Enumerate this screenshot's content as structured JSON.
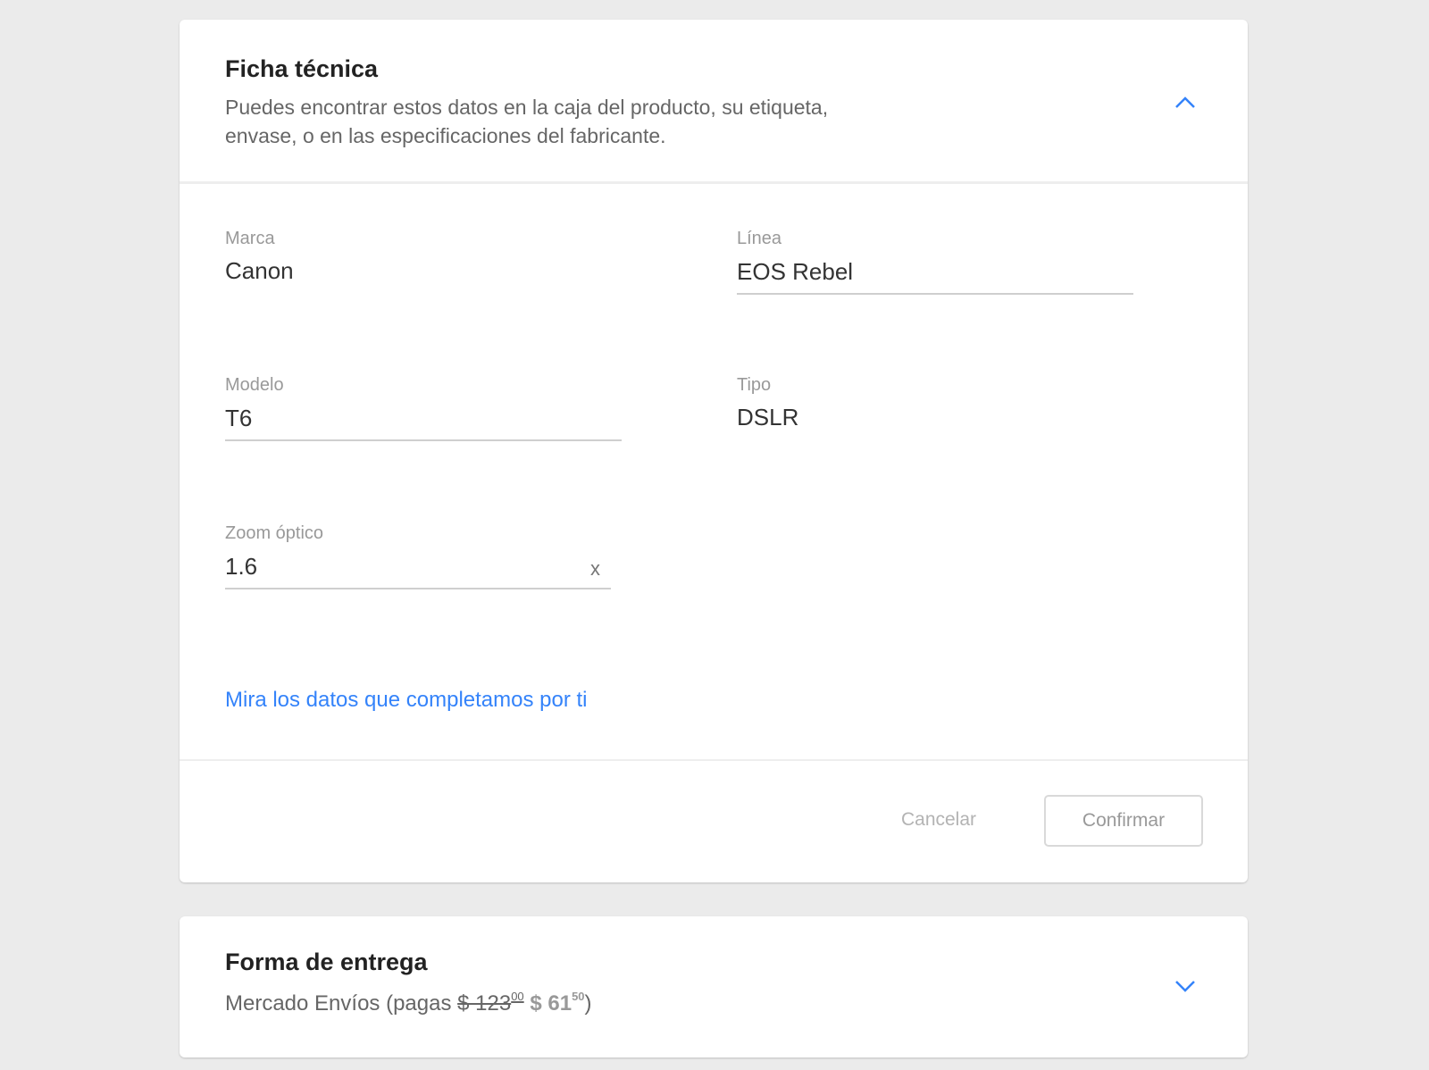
{
  "ficha": {
    "title": "Ficha técnica",
    "subtitle": "Puedes encontrar estos datos en la caja del producto, su etiqueta, envase, o en las especificaciones del fabricante.",
    "toggle_icon": "chevron-up-icon",
    "fields": {
      "marca": {
        "label": "Marca",
        "value": "Canon"
      },
      "linea": {
        "label": "Línea",
        "value": "EOS Rebel"
      },
      "modelo": {
        "label": "Modelo",
        "value": "T6"
      },
      "tipo": {
        "label": "Tipo",
        "value": "DSLR"
      },
      "zoom": {
        "label": "Zoom óptico",
        "value": "1.6",
        "clear_label": "x"
      }
    },
    "link_text": "Mira los datos que completamos por ti",
    "cancel_label": "Cancelar",
    "confirm_label": "Confirmar"
  },
  "entrega": {
    "title": "Forma de entrega",
    "shipping_prefix": "Mercado Envíos (pagas ",
    "old_price_main": "$ 123",
    "old_price_cents": "00",
    "new_price_main": "$ 61",
    "new_price_cents": "50",
    "shipping_suffix": ")",
    "toggle_icon": "chevron-down-icon"
  },
  "colors": {
    "accent": "#3483fa",
    "background": "#ebebeb",
    "card": "#ffffff"
  }
}
